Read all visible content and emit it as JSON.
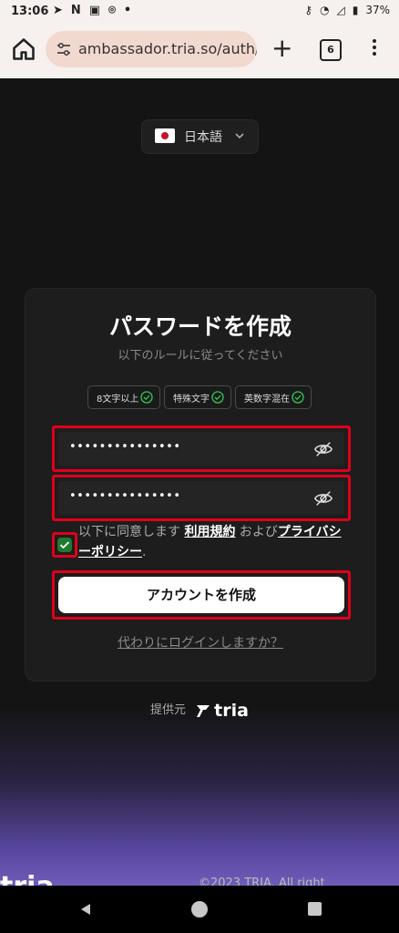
{
  "status_bar": {
    "time": "13:06",
    "battery": "37%"
  },
  "browser": {
    "url": "ambassador.tria.so/auth/c",
    "tab_count": "6"
  },
  "language": {
    "label": "日本語"
  },
  "form": {
    "title": "パスワードを作成",
    "subtitle": "以下のルールに従ってください",
    "rules": [
      "8文字以上",
      "特殊文字",
      "英数字混在"
    ],
    "password": "•••••••••••••••",
    "confirm_password": "•••••••••••••••",
    "agree_prefix": "以下に同意します",
    "terms_link": "利用規約",
    "agree_and": "および",
    "privacy_link": "プライバシーポリシー",
    "agree_suffix": ".",
    "submit": "アカウントを作成",
    "login_link": "代わりにログインしますか？"
  },
  "footer": {
    "powered_by": "提供元",
    "brand": "tria",
    "logo": "tria",
    "copyright": "©2023 TRIA. All right"
  },
  "colors": {
    "accent_check": "#1f7a2e",
    "highlight": "#e0001b"
  }
}
